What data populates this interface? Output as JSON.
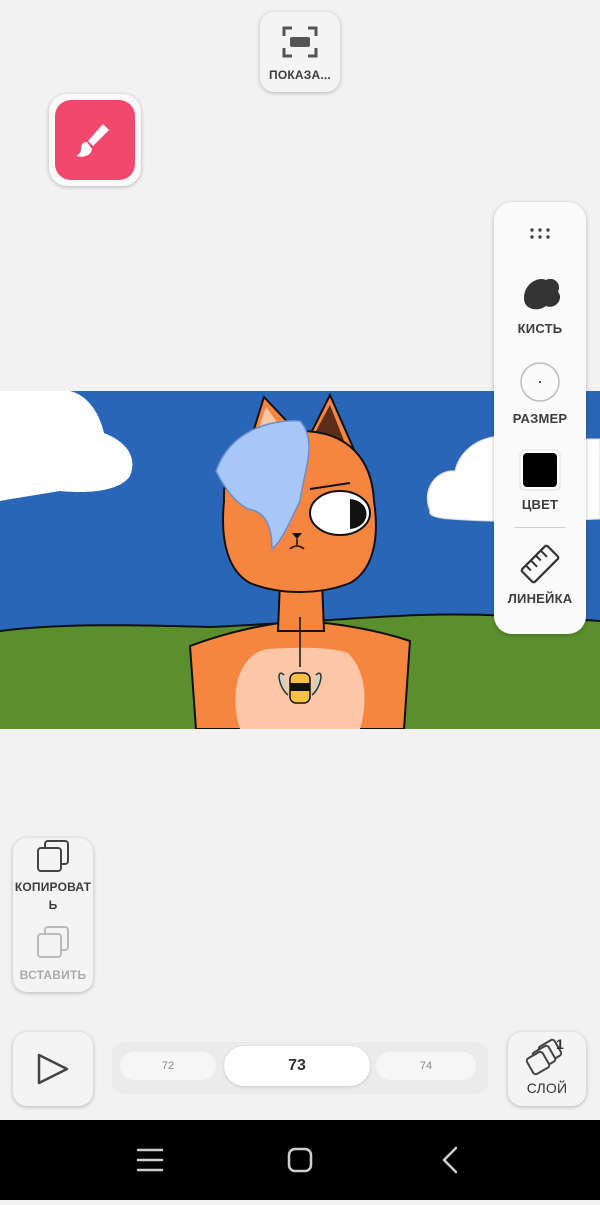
{
  "top": {
    "fullscreen_label": "ПОКАЗА...",
    "fullscreen_icon": "fullscreen-icon",
    "brush_mode_icon": "paintbrush-icon",
    "brush_mode_color": "#f2486d"
  },
  "tools": {
    "drag_icon": "drag-handle-icon",
    "brush_label": "КИСТЬ",
    "size_label": "РАЗМЕР",
    "color_label": "ЦВЕТ",
    "current_color": "#000000",
    "ruler_label": "ЛИНЕЙКА"
  },
  "edit": {
    "copy_label": "КОПИРОВАТ Ь",
    "paste_label": "ВСТАВИТЬ"
  },
  "frames": {
    "prev": "72",
    "current": "73",
    "next": "74"
  },
  "layer": {
    "label": "СЛОЙ",
    "count": "1"
  },
  "canvas": {
    "sky": "#2a66b8",
    "grass": "#5b8f2e"
  }
}
